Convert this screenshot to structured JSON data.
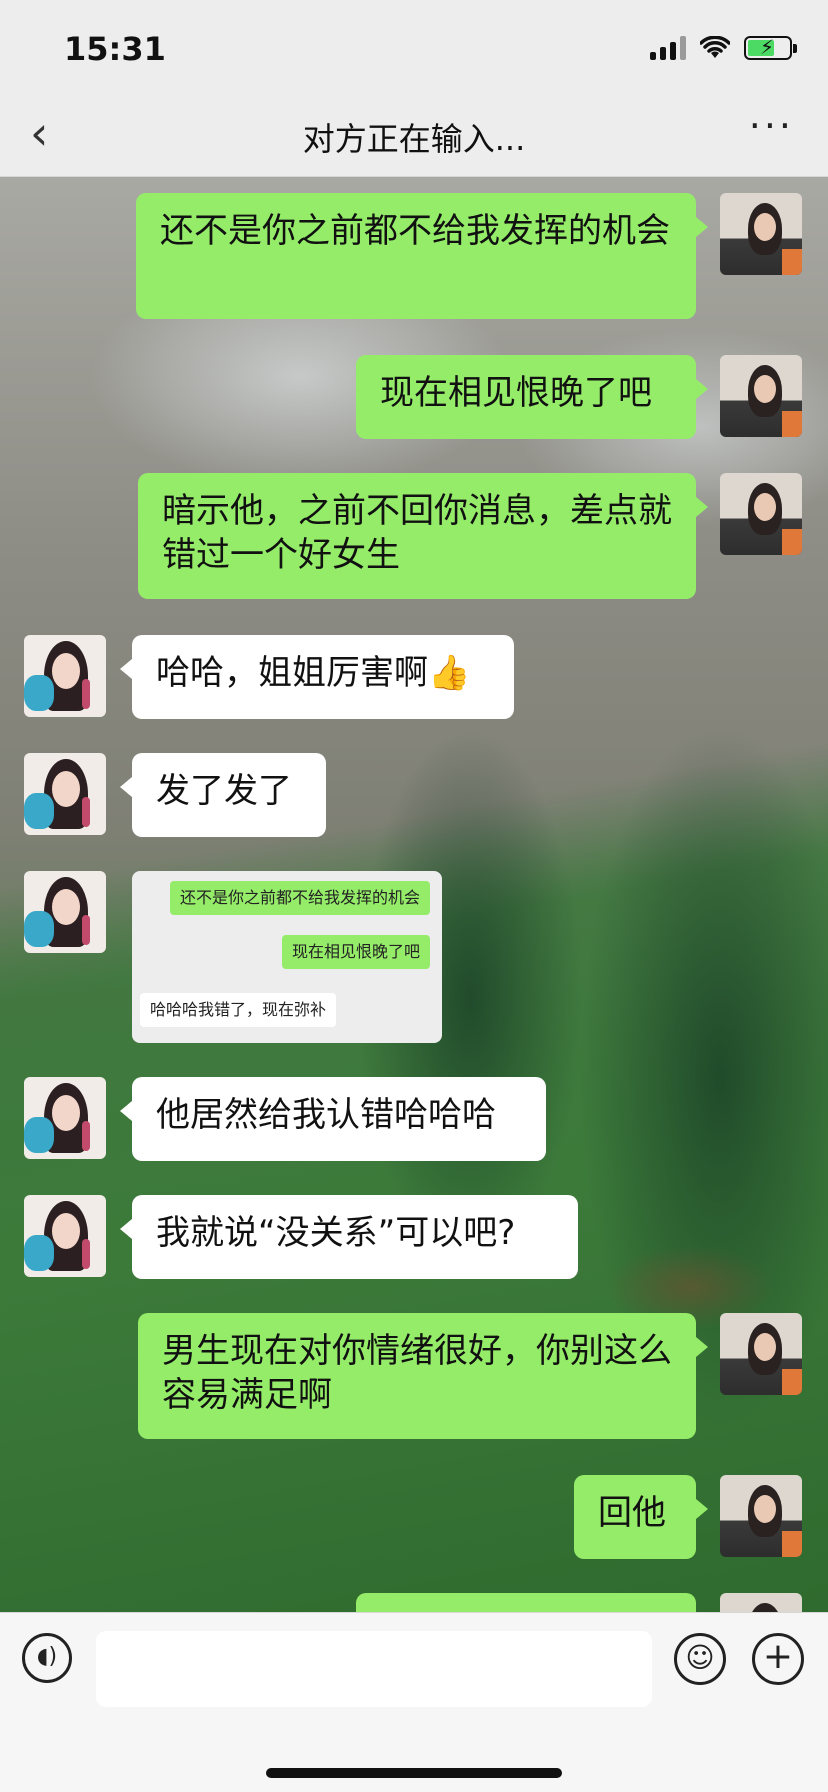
{
  "status_bar": {
    "time": "15:31"
  },
  "nav": {
    "back_icon": "chevron-left-icon",
    "title": "对方正在输入...",
    "more_icon": "more-dots-icon"
  },
  "messages": [
    {
      "from": "me",
      "text": "还不是你之前都不给我发挥的机会"
    },
    {
      "from": "me",
      "text": "现在相见恨晚了吧"
    },
    {
      "from": "me",
      "text": "暗示他，之前不回你消息，差点就错过一个好女生"
    },
    {
      "from": "her",
      "text": "哈哈，姐姐厉害啊👍"
    },
    {
      "from": "her",
      "text": "发了发了"
    },
    {
      "from": "her",
      "type": "image",
      "quoted": [
        {
          "side": "right",
          "text": "还不是你之前都不给我发挥的机会"
        },
        {
          "side": "right",
          "text": "现在相见恨晚了吧"
        },
        {
          "side": "left",
          "text": "哈哈哈我错了，现在弥补"
        }
      ]
    },
    {
      "from": "her",
      "text": "他居然给我认错哈哈哈"
    },
    {
      "from": "her",
      "text": "我就说“没关系”可以吧?"
    },
    {
      "from": "me",
      "text": "男生现在对你情绪很好，你别这么容易满足啊"
    },
    {
      "from": "me",
      "text": "回他"
    }
  ],
  "input_bar": {
    "voice_icon": "voice-icon",
    "text_value": "",
    "emoji_icon": "emoji-icon",
    "plus_icon": "plus-icon"
  },
  "colors": {
    "my_bubble": "#95ec69",
    "their_bubble": "#ffffff",
    "bar_bg": "#ededed"
  }
}
